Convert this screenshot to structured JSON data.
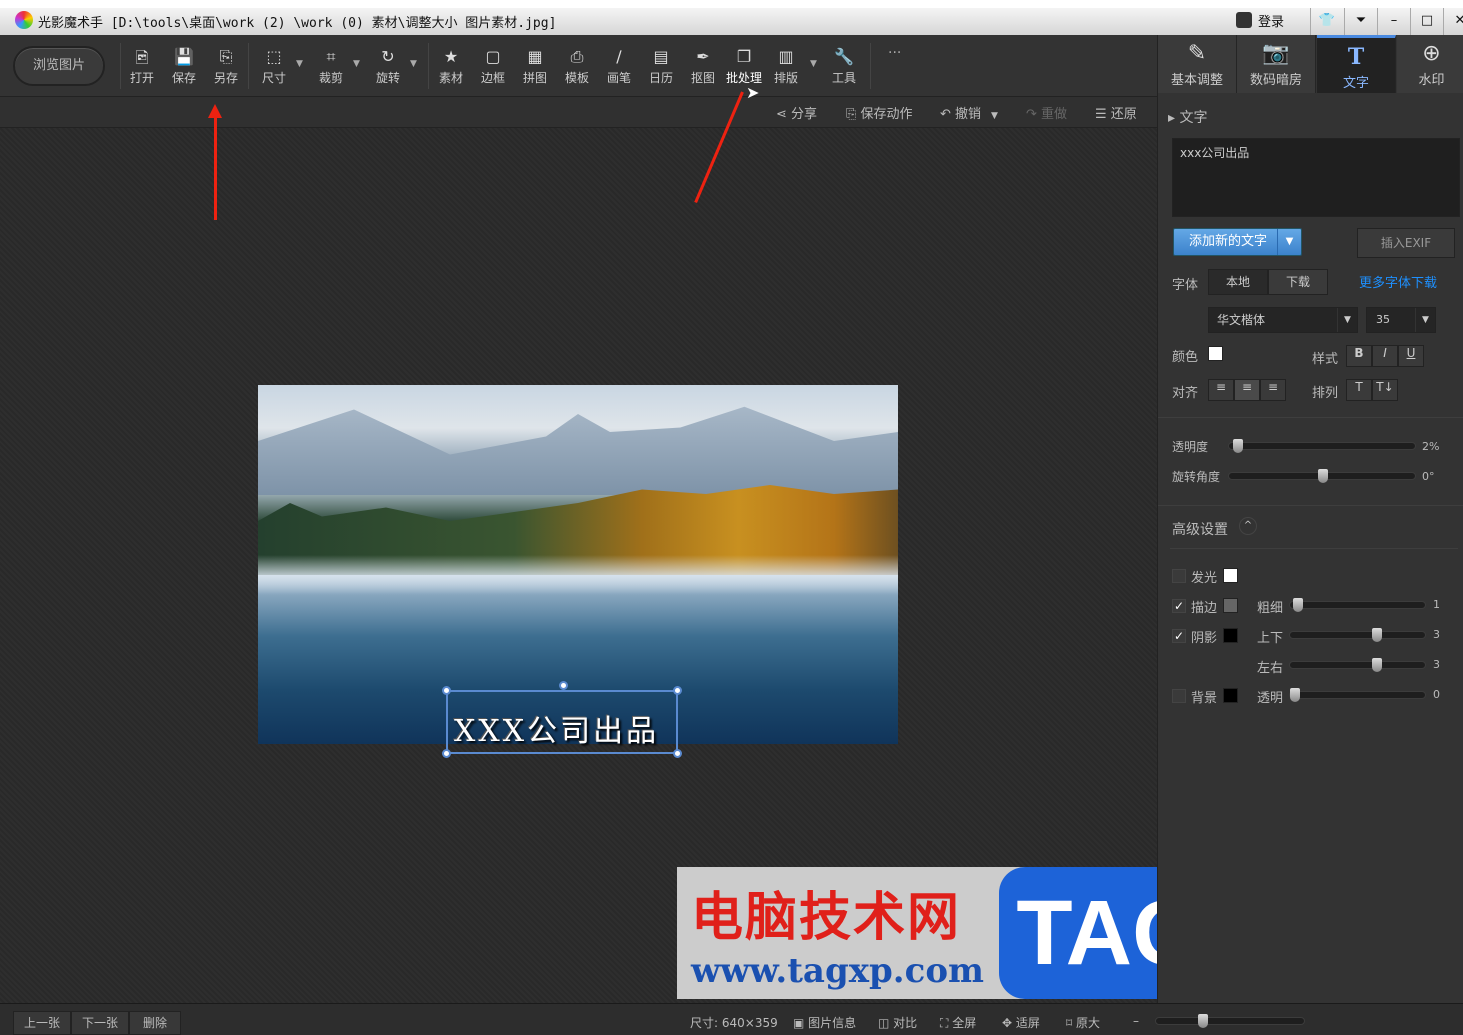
{
  "titlebar": {
    "title": "光影魔术手 [D:\\tools\\桌面\\work (2) \\work (0) 素材\\调整大小 图片素材.jpg]",
    "login": "登录",
    "buttons": [
      "skin",
      "menu",
      "minimize",
      "maximize",
      "close"
    ]
  },
  "toolbar": {
    "browse": "浏览图片",
    "tools": [
      {
        "label": "打开",
        "icon": "open-icon"
      },
      {
        "label": "保存",
        "icon": "save-icon"
      },
      {
        "label": "另存",
        "icon": "save-as-icon"
      },
      {
        "label": "尺寸",
        "icon": "resize-icon"
      },
      {
        "label": "裁剪",
        "icon": "crop-icon"
      },
      {
        "label": "旋转",
        "icon": "rotate-icon"
      },
      {
        "label": "素材",
        "icon": "material-icon"
      },
      {
        "label": "边框",
        "icon": "border-icon"
      },
      {
        "label": "拼图",
        "icon": "collage-icon"
      },
      {
        "label": "模板",
        "icon": "template-icon"
      },
      {
        "label": "画笔",
        "icon": "brush-icon"
      },
      {
        "label": "日历",
        "icon": "calendar-icon"
      },
      {
        "label": "抠图",
        "icon": "cutout-icon"
      },
      {
        "label": "批处理",
        "icon": "batch-icon"
      },
      {
        "label": "排版",
        "icon": "layout-icon"
      },
      {
        "label": "工具",
        "icon": "wrench-icon"
      }
    ],
    "more": "···"
  },
  "subbar": {
    "share": "分享",
    "save_action": "保存动作",
    "undo": "撤销",
    "redo": "重做",
    "restore": "还原"
  },
  "canvas": {
    "overlay_text": "XXX公司出品"
  },
  "watermark": {
    "cn": "电脑技术网",
    "url": "www.tagxp.com",
    "tag": "TAG"
  },
  "right": {
    "tabs": [
      {
        "label": "基本调整"
      },
      {
        "label": "数码暗房"
      },
      {
        "label": "文字"
      },
      {
        "label": "水印"
      }
    ],
    "section": "文字",
    "text_value": "xxx公司出品",
    "add_text": "添加新的文字",
    "insert_exif": "插入EXIF",
    "font_label": "字体",
    "font_local": "本地",
    "font_download": "下载",
    "more_fonts": "更多字体下载",
    "font_name": "华文楷体",
    "font_size": "35",
    "color_label": "颜色",
    "text_color": "#ffffff",
    "style_label": "样式",
    "bold": "B",
    "italic": "I",
    "underline": "U",
    "align_label": "对齐",
    "arrange_label": "排列",
    "opacity_label": "透明度",
    "opacity_value": "2%",
    "opacity": 2,
    "rotation_label": "旋转角度",
    "rotation_value": "0°",
    "rotation": 0,
    "advanced": "高级设置",
    "glow": {
      "label": "发光",
      "checked": false,
      "color": "#ffffff"
    },
    "stroke": {
      "label": "描边",
      "checked": true,
      "color": "#666666",
      "thickness_label": "粗细",
      "thickness": "1"
    },
    "shadow": {
      "label": "阴影",
      "checked": true,
      "color": "#000000",
      "vertical_label": "上下",
      "vertical": "3",
      "horizontal_label": "左右",
      "horizontal": "3"
    },
    "background": {
      "label": "背景",
      "checked": false,
      "color": "#000000",
      "opacity_label": "透明",
      "opacity": "0"
    }
  },
  "bottombar": {
    "prev": "上一张",
    "next": "下一张",
    "delete": "删除",
    "size": "尺寸: 640×359",
    "info": "图片信息",
    "compare": "对比",
    "fullscreen": "全屏",
    "fit": "适屏",
    "original": "原大"
  }
}
